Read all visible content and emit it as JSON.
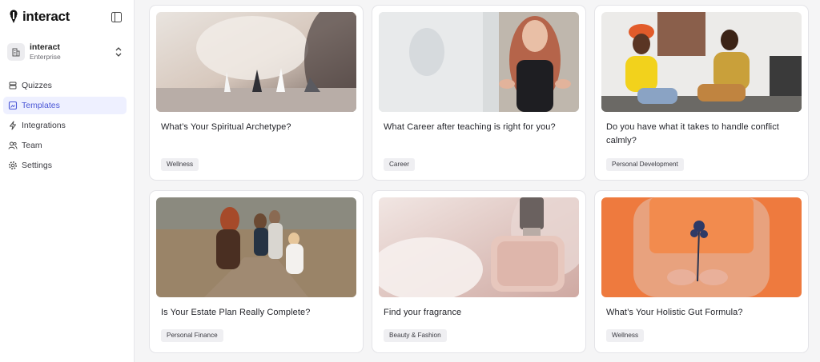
{
  "brand": {
    "name": "interact"
  },
  "org": {
    "name": "interact",
    "plan": "Enterprise"
  },
  "nav": [
    {
      "label": "Quizzes",
      "icon": "stack-icon",
      "active": false
    },
    {
      "label": "Templates",
      "icon": "templates-icon",
      "active": true
    },
    {
      "label": "Integrations",
      "icon": "bolt-icon",
      "active": false
    },
    {
      "label": "Team",
      "icon": "team-icon",
      "active": false
    },
    {
      "label": "Settings",
      "icon": "gear-icon",
      "active": false
    }
  ],
  "templates": [
    {
      "title": "What’s Your Spiritual Archetype?",
      "tag": "Wellness",
      "image": "crystals-photo"
    },
    {
      "title": "What Career after teaching is right for you?",
      "tag": "Career",
      "image": "teacher-photo"
    },
    {
      "title": "Do you have what it takes to handle conflict calmly?",
      "tag": "Personal Development",
      "image": "conversation-photo"
    },
    {
      "title": "Is Your Estate Plan Really Complete?",
      "tag": "Personal Finance",
      "image": "family-walk-photo"
    },
    {
      "title": "Find your fragrance",
      "tag": "Beauty & Fashion",
      "image": "perfume-photo"
    },
    {
      "title": "What’s Your Holistic Gut Formula?",
      "tag": "Wellness",
      "image": "flower-photo"
    }
  ],
  "colors": {
    "accent": "#4b57d6",
    "active_bg": "#eef0ff",
    "tag_bg": "#efeff2"
  }
}
